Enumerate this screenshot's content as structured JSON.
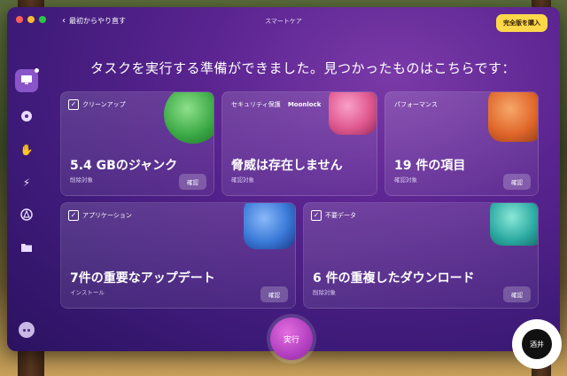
{
  "window": {
    "title": "スマートケア",
    "back_label": "最初からやり直す",
    "buy_button": "完全版を購入"
  },
  "sidebar": {
    "items": [
      {
        "icon": "monitor-icon",
        "active": true
      },
      {
        "icon": "cleanup-disk-icon"
      },
      {
        "icon": "hand-icon"
      },
      {
        "icon": "lightning-icon"
      },
      {
        "icon": "apps-icon"
      },
      {
        "icon": "folder-icon"
      }
    ],
    "bottom_icon": "assistant-icon"
  },
  "headline": "タスクを実行する準備ができました。見つかったものはこちらです：",
  "cards": {
    "cleanup": {
      "label": "クリーンアップ",
      "value": "5.4 GBのジャンク",
      "sub": "削除対象",
      "button": "確認",
      "accent": "#3aa845"
    },
    "security": {
      "label": "セキュリティ保護",
      "brand": "Moonlock",
      "value": "脅威は存在しません",
      "sub": "確認対象",
      "accent": "#e05a90"
    },
    "performance": {
      "label": "パフォーマンス",
      "value": "19 件の項目",
      "sub": "確認対象",
      "button": "確認",
      "accent": "#e0662a"
    },
    "apps": {
      "label": "アプリケーション",
      "value": "7件の重要なアップデート",
      "sub": "インストール",
      "button": "確認",
      "accent": "#3a7ad8"
    },
    "clutter": {
      "label": "不要データ",
      "value": "6 件の重複したダウンロード",
      "sub": "削除対象",
      "button": "確認",
      "accent": "#2aa8a0"
    }
  },
  "run_button": "実行",
  "watermark": "酒井"
}
